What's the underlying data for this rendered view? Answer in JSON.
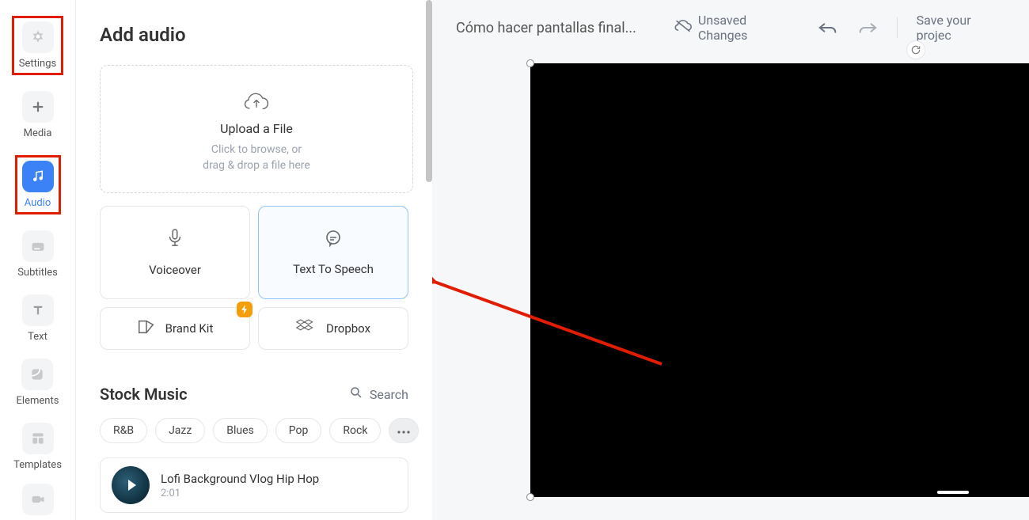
{
  "sidebar": {
    "items": [
      {
        "id": "settings",
        "label": "Settings"
      },
      {
        "id": "media",
        "label": "Media"
      },
      {
        "id": "audio",
        "label": "Audio"
      },
      {
        "id": "subtitles",
        "label": "Subtitles"
      },
      {
        "id": "text",
        "label": "Text"
      },
      {
        "id": "elements",
        "label": "Elements"
      },
      {
        "id": "templates",
        "label": "Templates"
      }
    ]
  },
  "panel": {
    "title": "Add audio",
    "upload": {
      "title": "Upload a File",
      "sub_line1": "Click to browse, or",
      "sub_line2": "drag & drop a file here"
    },
    "cards": {
      "voiceover": "Voiceover",
      "tts": "Text To Speech",
      "brandkit": "Brand Kit",
      "dropbox": "Dropbox"
    },
    "stock": {
      "title": "Stock Music",
      "search": "Search",
      "chips": [
        "R&B",
        "Jazz",
        "Blues",
        "Pop",
        "Rock"
      ],
      "track": {
        "name": "Lofi Background Vlog Hip Hop",
        "duration": "2:01"
      }
    }
  },
  "topbar": {
    "project_title": "Cómo hacer pantallas final...",
    "unsaved": "Unsaved Changes",
    "save": "Save your projec"
  }
}
